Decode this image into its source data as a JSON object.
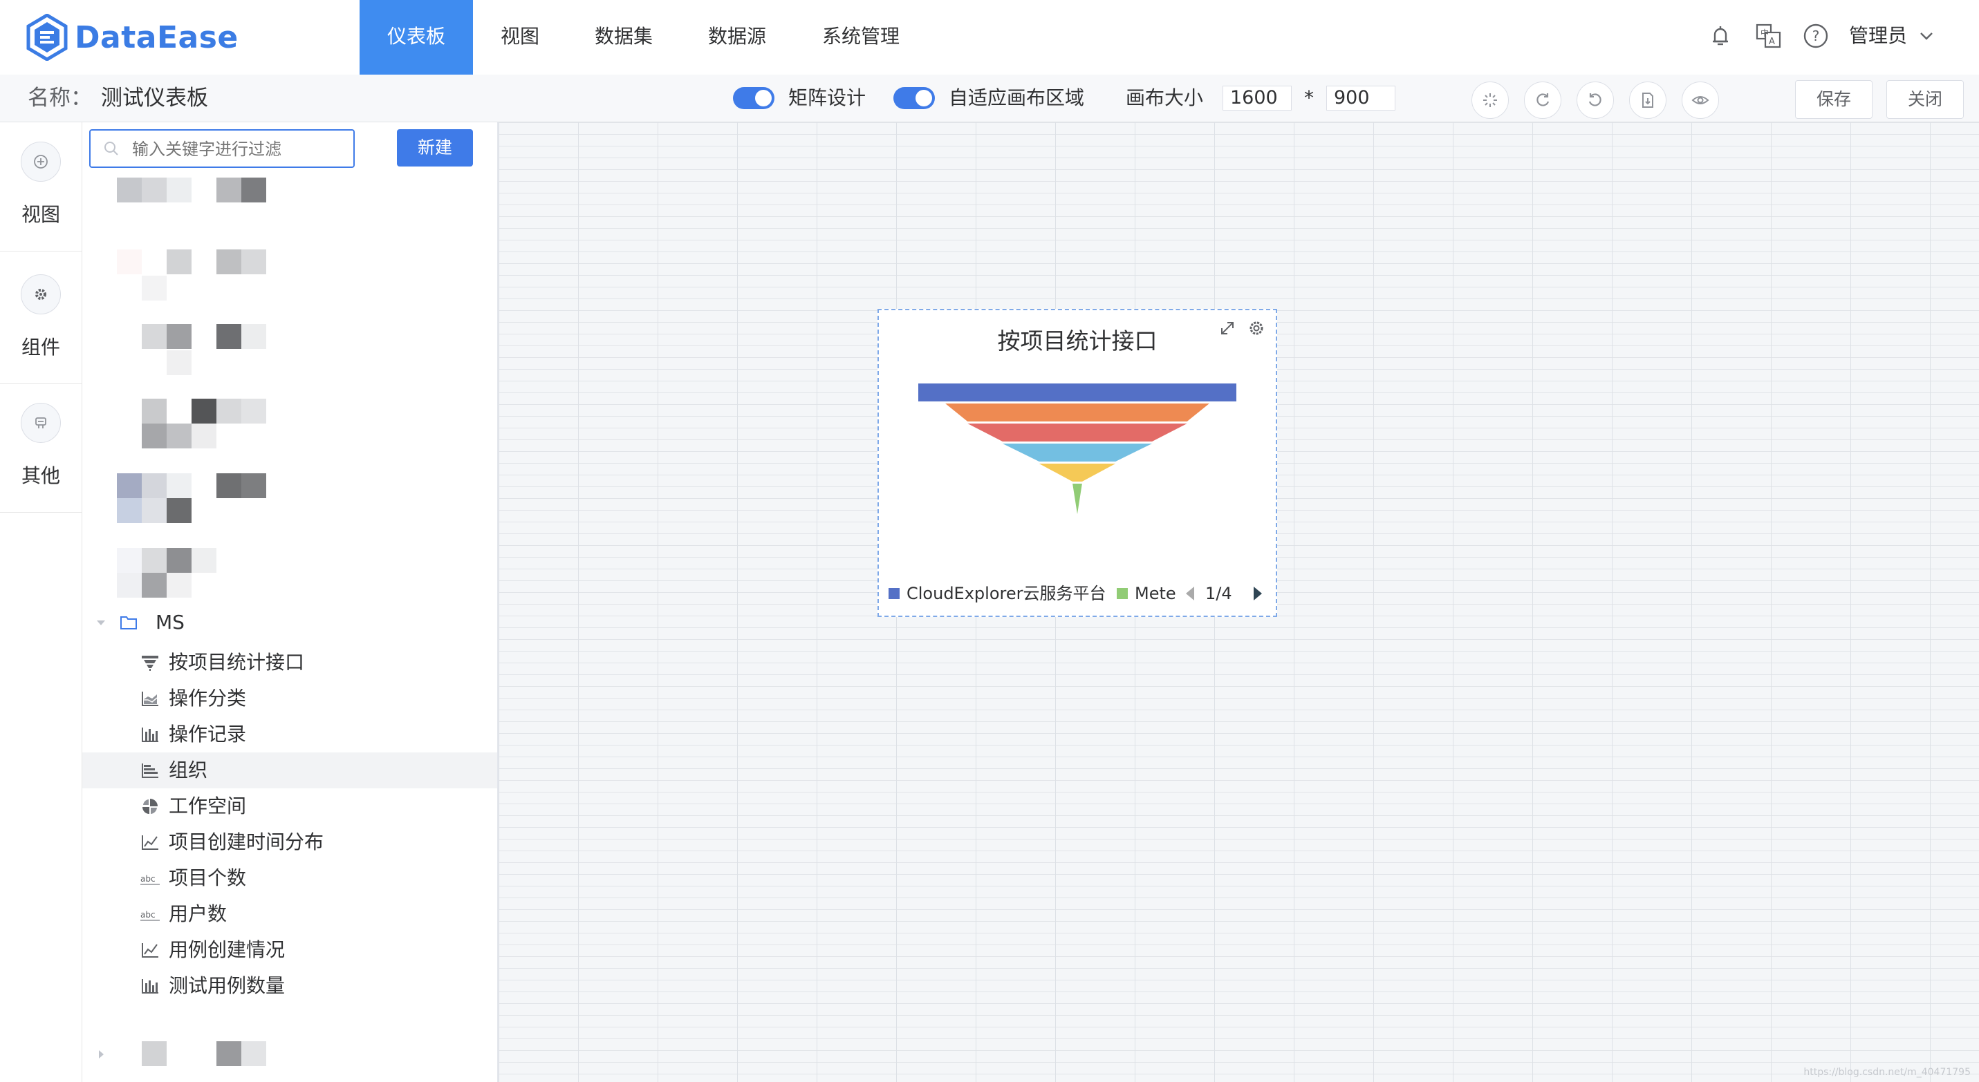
{
  "app": {
    "name": "DataEase"
  },
  "nav": {
    "items": [
      {
        "label": "仪表板",
        "active": true
      },
      {
        "label": "视图",
        "active": false
      },
      {
        "label": "数据集",
        "active": false
      },
      {
        "label": "数据源",
        "active": false
      },
      {
        "label": "系统管理",
        "active": false
      }
    ],
    "user": "管理员",
    "icons": [
      "notification-icon",
      "translate-icon",
      "help-icon",
      "chevron-down-icon"
    ]
  },
  "toolbar": {
    "name_label": "名称：",
    "name_value": "测试仪表板",
    "matrix_label": "矩阵设计",
    "matrix_on": true,
    "adaptive_label": "自适应画布区域",
    "adaptive_on": true,
    "canvas_size_label": "画布大小",
    "canvas_width": "1600",
    "times": "*",
    "canvas_height": "900",
    "icons": [
      "clean-icon",
      "refresh-icon",
      "undo-icon",
      "export-icon",
      "preview-icon"
    ],
    "save_label": "保存",
    "close_label": "关闭"
  },
  "rail": {
    "items": [
      {
        "label": "视图",
        "icon": "add-circle-icon"
      },
      {
        "label": "组件",
        "icon": "component-gear-icon"
      },
      {
        "label": "其他",
        "icon": "other-icon"
      }
    ]
  },
  "panel": {
    "search_placeholder": "输入关键字进行过滤",
    "new_label": "新建",
    "folder": "MS",
    "views": [
      {
        "label": "按项目统计接口",
        "icon": "funnel-icon",
        "selected": false
      },
      {
        "label": "操作分类",
        "icon": "area-chart-icon",
        "selected": false
      },
      {
        "label": "操作记录",
        "icon": "bar-chart-icon",
        "selected": false
      },
      {
        "label": "组织",
        "icon": "horizontal-bar-icon",
        "selected": true
      },
      {
        "label": "工作空间",
        "icon": "pie-chart-icon",
        "selected": false
      },
      {
        "label": "项目创建时间分布",
        "icon": "line-chart-icon",
        "selected": false
      },
      {
        "label": "项目个数",
        "icon": "text-abc-icon",
        "selected": false
      },
      {
        "label": "用户数",
        "icon": "text-abc-icon",
        "selected": false
      },
      {
        "label": "用例创建情况",
        "icon": "line-chart-icon",
        "selected": false
      },
      {
        "label": "测试用例数量",
        "icon": "bar-chart-icon",
        "selected": false
      }
    ]
  },
  "chart": {
    "title": "按项目统计接口",
    "legend": [
      {
        "name": "CloudExplorer云服务平台",
        "color": "#5470c6"
      },
      {
        "name": "Meter",
        "color": "#91cc75"
      }
    ],
    "legend_page": "1/4"
  },
  "chart_data": {
    "type": "funnel",
    "title": "按项目统计接口",
    "categories": [
      "CloudExplorer云服务平台",
      "",
      "",
      "",
      "",
      "Meter"
    ],
    "values": [
      100,
      83,
      69,
      47,
      24,
      3
    ],
    "colors": [
      "#5470c6",
      "#ee8a52",
      "#e36b67",
      "#73bfe2",
      "#f5c956",
      "#91cc75"
    ]
  },
  "watermark": "https://blog.csdn.net/m_40471795"
}
